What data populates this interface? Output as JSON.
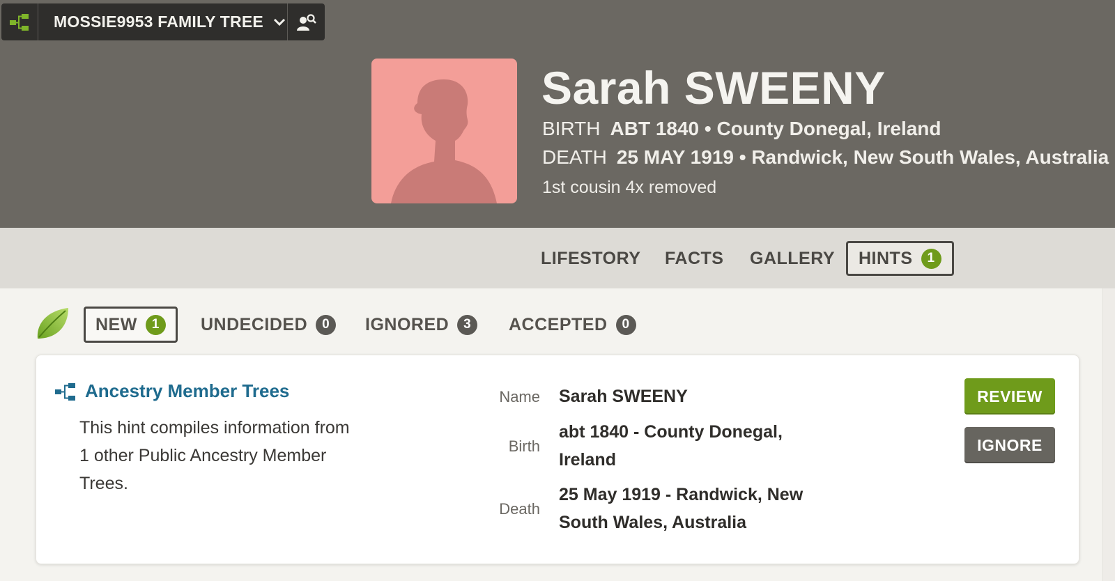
{
  "tree_bar": {
    "tree_name": "MOSSIE9953 FAMILY TREE"
  },
  "person": {
    "name": "Sarah SWEENY",
    "birth_label": "BIRTH",
    "birth_value": "ABT 1840 • County Donegal, Ireland",
    "death_label": "DEATH",
    "death_value": "25 MAY 1919 • Randwick, New South Wales, Australia",
    "relationship": "1st cousin 4x removed"
  },
  "main_tabs": [
    {
      "label": "LIFESTORY"
    },
    {
      "label": "FACTS"
    },
    {
      "label": "GALLERY"
    },
    {
      "label": "HINTS",
      "count": "1",
      "active": true
    }
  ],
  "hint_tabs": [
    {
      "label": "NEW",
      "count": "1",
      "active": true
    },
    {
      "label": "UNDECIDED",
      "count": "0"
    },
    {
      "label": "IGNORED",
      "count": "3"
    },
    {
      "label": "ACCEPTED",
      "count": "0"
    }
  ],
  "hint": {
    "source_title": "Ancestry Member Trees",
    "description": "This hint compiles information from 1 other Public Ancestry Member Trees.",
    "fields": [
      {
        "label": "Name",
        "value": "Sarah SWEENY"
      },
      {
        "label": "Birth",
        "value": "abt 1840 - County Donegal, Ireland"
      },
      {
        "label": "Death",
        "value": "25 May 1919 - Randwick, New South Wales, Australia"
      }
    ],
    "review_label": "REVIEW",
    "ignore_label": "IGNORE"
  },
  "colors": {
    "header_bg": "#6b6862",
    "accent_green": "#6f9b1b",
    "link_blue": "#1f6b8e"
  }
}
